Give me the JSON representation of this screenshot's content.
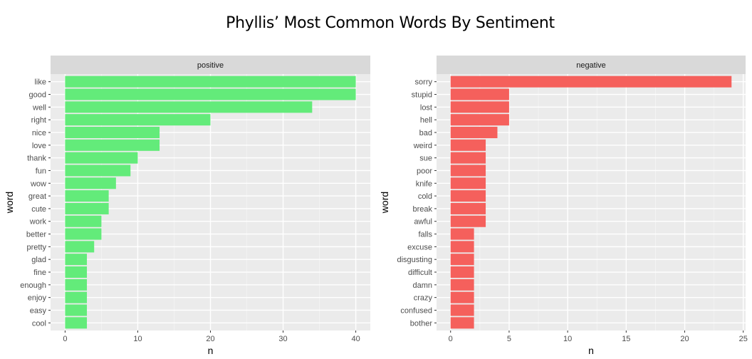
{
  "chart_data": [
    {
      "type": "bar",
      "orientation": "horizontal",
      "facet": "positive",
      "color": "#63EB7A",
      "categories": [
        "like",
        "good",
        "well",
        "right",
        "nice",
        "love",
        "thank",
        "fun",
        "wow",
        "great",
        "cute",
        "work",
        "better",
        "pretty",
        "glad",
        "fine",
        "enough",
        "enjoy",
        "easy",
        "cool"
      ],
      "values": [
        40,
        40,
        34,
        20,
        13,
        13,
        10,
        9,
        7,
        6,
        6,
        5,
        5,
        4,
        3,
        3,
        3,
        3,
        3,
        3
      ],
      "xlabel": "n",
      "ylabel": "word",
      "xlim": [
        -2,
        42
      ],
      "xticks": [
        0,
        10,
        20,
        30,
        40
      ],
      "grid": true
    },
    {
      "type": "bar",
      "orientation": "horizontal",
      "facet": "negative",
      "color": "#F5605C",
      "categories": [
        "sorry",
        "stupid",
        "lost",
        "hell",
        "bad",
        "weird",
        "sue",
        "poor",
        "knife",
        "cold",
        "break",
        "awful",
        "falls",
        "excuse",
        "disgusting",
        "difficult",
        "damn",
        "crazy",
        "confused",
        "bother"
      ],
      "values": [
        24,
        5,
        5,
        5,
        4,
        3,
        3,
        3,
        3,
        3,
        3,
        3,
        2,
        2,
        2,
        2,
        2,
        2,
        2,
        2
      ],
      "xlabel": "n",
      "ylabel": "word",
      "xlim": [
        -1.2,
        25.2
      ],
      "xticks": [
        0,
        5,
        10,
        15,
        20,
        25
      ],
      "grid": true
    }
  ],
  "title": "Phyllis’ Most Common Words By Sentiment"
}
